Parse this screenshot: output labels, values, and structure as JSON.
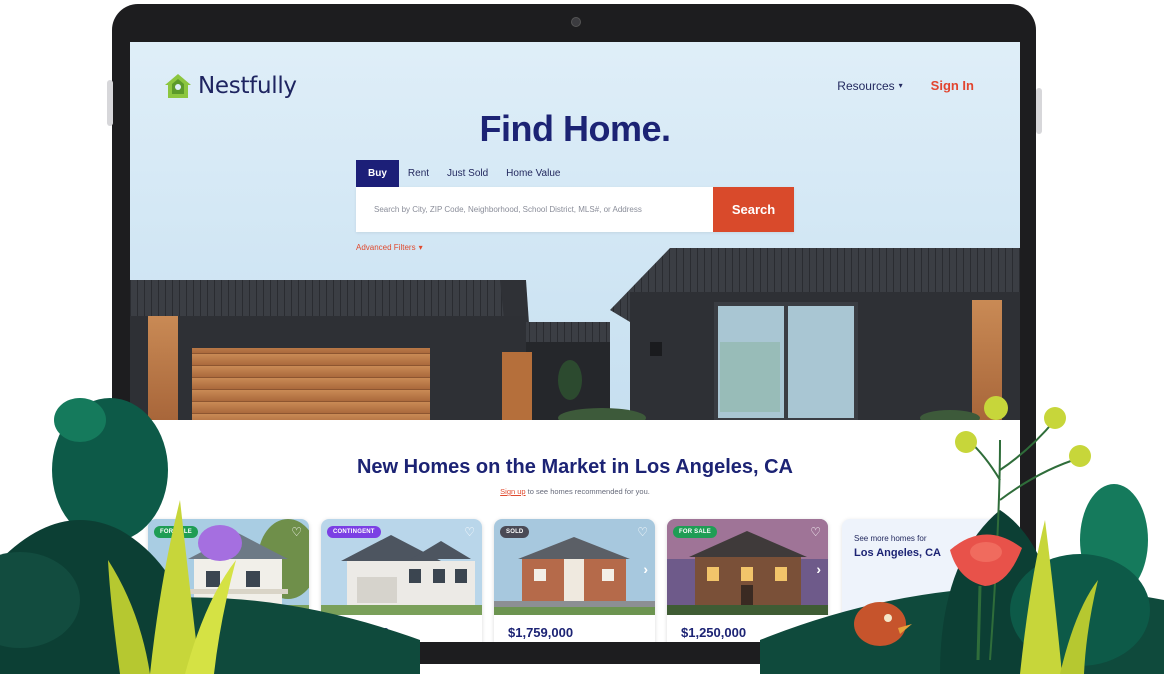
{
  "brand": {
    "name": "Nestfully"
  },
  "nav": {
    "resources_label": "Resources",
    "signin_label": "Sign In"
  },
  "hero": {
    "title": "Find Home.",
    "tabs": [
      {
        "label": "Buy",
        "active": true
      },
      {
        "label": "Rent",
        "active": false
      },
      {
        "label": "Just Sold",
        "active": false
      },
      {
        "label": "Home Value",
        "active": false
      }
    ],
    "search": {
      "placeholder": "Search by City, ZIP Code, Neighborhood, School District, MLS#, or Address",
      "button_label": "Search"
    },
    "advanced_filters_label": "Advanced Filters"
  },
  "listings": {
    "title": "New Homes on the Market in Los Angeles, CA",
    "subtitle_link": "Sign up",
    "subtitle_text": " to see homes recommended for you.",
    "cards": [
      {
        "badge": "FOR SALE",
        "badge_color": "#1f9d55",
        "price": ""
      },
      {
        "badge": "CONTINGENT",
        "badge_color": "#7b3fe4",
        "price": "$975,000"
      },
      {
        "badge": "SOLD",
        "badge_color": "#4a4a55",
        "price": "$1,759,000"
      },
      {
        "badge": "FOR SALE",
        "badge_color": "#1f9d55",
        "price": "$1,250,000"
      }
    ],
    "more": {
      "line1": "See more homes for",
      "line2": "Los Angeles, CA"
    }
  },
  "icons": {
    "heart": "heart-outline-icon",
    "arrow": "chevron-right-icon",
    "caret": "caret-down-icon"
  },
  "colors": {
    "navy": "#1c2374",
    "accent": "#d94a2b",
    "active_tab": "#1c1f78"
  }
}
